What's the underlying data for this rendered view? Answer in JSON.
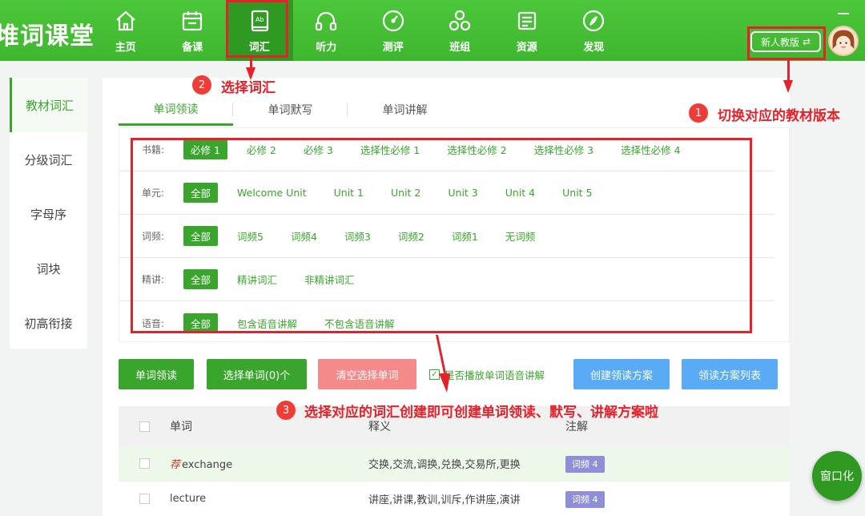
{
  "brand": "堆词课堂",
  "nav": [
    {
      "label": "主页",
      "icon": "home-icon"
    },
    {
      "label": "备课",
      "icon": "calendar-icon"
    },
    {
      "label": "词汇",
      "icon": "book-icon"
    },
    {
      "label": "听力",
      "icon": "headphones-icon"
    },
    {
      "label": "测评",
      "icon": "gauge-icon"
    },
    {
      "label": "班组",
      "icon": "group-icon"
    },
    {
      "label": "资源",
      "icon": "resource-icon"
    },
    {
      "label": "发现",
      "icon": "compass-icon"
    }
  ],
  "switch_label": "新人教版",
  "annotations": {
    "n1": "1",
    "t1": "切换对应的教材版本",
    "n2": "2",
    "t2": "选择词汇",
    "n3": "3",
    "t3": "选择对应的词汇创建即可创建单词领读、默写、讲解方案啦"
  },
  "sidebar": [
    "教材词汇",
    "分级词汇",
    "字母序",
    "词块",
    "初高衔接"
  ],
  "tabs": [
    "单词领读",
    "单词默写",
    "单词讲解"
  ],
  "filters": [
    {
      "label": "书籍:",
      "options": [
        "必修 1",
        "必修 2",
        "必修 3",
        "选择性必修 1",
        "选择性必修 2",
        "选择性必修 3",
        "选择性必修 4"
      ]
    },
    {
      "label": "单元:",
      "options": [
        "全部",
        "Welcome Unit",
        "Unit 1",
        "Unit 2",
        "Unit 3",
        "Unit 4",
        "Unit 5"
      ]
    },
    {
      "label": "词频:",
      "options": [
        "全部",
        "词频5",
        "词频4",
        "词频3",
        "词频2",
        "词频1",
        "无词频"
      ]
    },
    {
      "label": "精讲:",
      "options": [
        "全部",
        "精讲词汇",
        "非精讲词汇"
      ]
    },
    {
      "label": "语音:",
      "options": [
        "全部",
        "包含语音讲解",
        "不包含语音讲解"
      ]
    }
  ],
  "actions": {
    "read": "单词领读",
    "select": "选择单词(0)个",
    "clear": "清空选择单词",
    "play": "是否播放单词语音讲解",
    "create": "创建领读方案",
    "list": "领读方案列表"
  },
  "table": {
    "headers": [
      "单词",
      "释义",
      "注解"
    ],
    "rows": [
      {
        "rec": "荐",
        "word": "exchange",
        "def": "交换,交流,调换,兑换,交易所,更换",
        "note": "词频 4"
      },
      {
        "rec": "",
        "word": "lecture",
        "def": "讲座,讲课,教训,训斥,作讲座,演讲",
        "note": "词频 4"
      }
    ]
  },
  "float_btn": "窗口化"
}
